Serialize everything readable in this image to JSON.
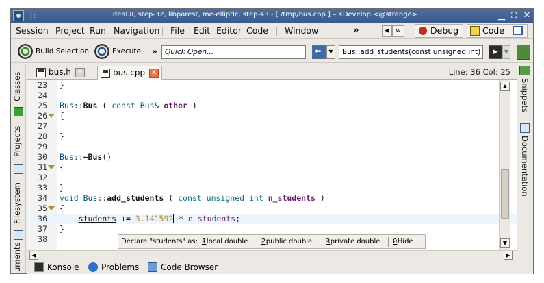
{
  "window": {
    "title": "deal.II, step-32, libparest, me-elliptic, step-43 - [ /tmp/bus.cpp ] – KDevelop <@strange>",
    "grip": "::",
    "minimize": "▁",
    "maximize": "⛶",
    "close": "✕"
  },
  "menu": {
    "items": [
      "Session",
      "Project",
      "Run",
      "Navigation",
      "File",
      "Edit",
      "Editor",
      "Code",
      "Window"
    ],
    "more": "»",
    "nav_back": "◀",
    "nav_forward": "▶",
    "partial_tab": "w",
    "debug_label": "Debug",
    "code_label": "Code"
  },
  "toolbar": {
    "build_label": "Build Selection",
    "execute_label": "Execute",
    "more": "»",
    "quick_open_placeholder": "Quick Open...",
    "dropdown_arrow": "▼",
    "context_value": "Bus::add_students(const unsigned int)"
  },
  "left_tools": {
    "classes": "Classes",
    "projects": "Projects",
    "filesystem": "Filesystem",
    "documents": "uments"
  },
  "right_tools": {
    "snippets": "Snippets",
    "documentation": "Documentation"
  },
  "tabs": [
    {
      "label": "bus.h",
      "active": false
    },
    {
      "label": "bus.cpp",
      "active": true
    }
  ],
  "cursor_position": "Line: 36 Col: 25",
  "code_lines": [
    {
      "n": "23",
      "fold": false,
      "tokens": [
        {
          "t": "}",
          "c": "k-plain"
        }
      ]
    },
    {
      "n": "24",
      "fold": false,
      "tokens": []
    },
    {
      "n": "25",
      "fold": false,
      "tokens": [
        {
          "t": "Bus::",
          "c": "k-cls"
        },
        {
          "t": "Bus",
          "c": "k-name"
        },
        {
          "t": " ( ",
          "c": "k-plain"
        },
        {
          "t": "const",
          "c": "k-type"
        },
        {
          "t": " Bus& ",
          "c": "k-cls"
        },
        {
          "t": "other",
          "c": "k-param"
        },
        {
          "t": " )",
          "c": "k-plain"
        }
      ]
    },
    {
      "n": "26",
      "fold": true,
      "tokens": [
        {
          "t": "{",
          "c": "k-plain"
        }
      ]
    },
    {
      "n": "27",
      "fold": false,
      "tokens": []
    },
    {
      "n": "28",
      "fold": false,
      "tokens": [
        {
          "t": "}",
          "c": "k-plain"
        }
      ]
    },
    {
      "n": "29",
      "fold": false,
      "tokens": []
    },
    {
      "n": "30",
      "fold": false,
      "tokens": [
        {
          "t": "Bus::",
          "c": "k-cls"
        },
        {
          "t": "~Bus",
          "c": "k-name"
        },
        {
          "t": "()",
          "c": "k-plain"
        }
      ]
    },
    {
      "n": "31",
      "fold": true,
      "tokens": [
        {
          "t": "{",
          "c": "k-plain"
        }
      ]
    },
    {
      "n": "32",
      "fold": false,
      "tokens": []
    },
    {
      "n": "33",
      "fold": false,
      "tokens": [
        {
          "t": "}",
          "c": "k-plain"
        }
      ]
    },
    {
      "n": "34",
      "fold": false,
      "tokens": [
        {
          "t": "void",
          "c": "k-type"
        },
        {
          "t": " Bus::",
          "c": "k-cls"
        },
        {
          "t": "add_students",
          "c": "k-name"
        },
        {
          "t": " ( ",
          "c": "k-plain"
        },
        {
          "t": "const unsigned int",
          "c": "k-type"
        },
        {
          "t": " ",
          "c": "k-plain"
        },
        {
          "t": "n_students",
          "c": "k-param"
        },
        {
          "t": " )",
          "c": "k-plain"
        }
      ]
    },
    {
      "n": "35",
      "fold": true,
      "tokens": [
        {
          "t": "{",
          "c": "k-plain"
        }
      ]
    },
    {
      "n": "36",
      "fold": false,
      "current": true,
      "tokens": [
        {
          "t": "    ",
          "c": "k-plain"
        },
        {
          "t": "students",
          "c": "k-plain underline"
        },
        {
          "t": " += ",
          "c": "k-plain"
        },
        {
          "t": "3.141592",
          "c": "k-num"
        },
        {
          "t": "|cursor|",
          "c": "cursor"
        },
        {
          "t": " * ",
          "c": "k-plain"
        },
        {
          "t": "n_students",
          "c": "k-id"
        },
        {
          "t": ";",
          "c": "k-plain"
        }
      ]
    },
    {
      "n": "37",
      "fold": false,
      "tokens": [
        {
          "t": "}",
          "c": "k-plain"
        }
      ]
    },
    {
      "n": "38",
      "fold": false,
      "tokens": []
    }
  ],
  "assistant": {
    "prompt": "Declare \"students\" as:",
    "options": [
      {
        "key": "1",
        "label": " - local double"
      },
      {
        "key": "2",
        "label": " - public double"
      },
      {
        "key": "3",
        "label": " - private double"
      },
      {
        "key": "0",
        "label": " - Hide"
      }
    ]
  },
  "scroll": {
    "up": "▲",
    "down": "▼",
    "left": "◀",
    "right": "▶"
  },
  "bottom_tools": [
    "Konsole",
    "Problems",
    "Code Browser"
  ]
}
